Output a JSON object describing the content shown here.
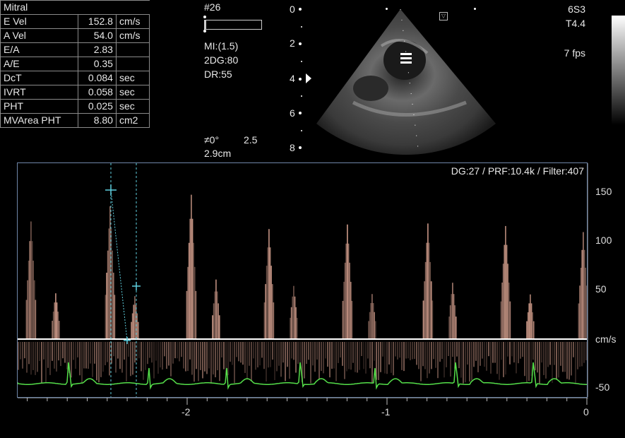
{
  "measurements": {
    "title": "Mitral",
    "rows": [
      {
        "label": "E Vel",
        "value": "152.8",
        "unit": "cm/s"
      },
      {
        "label": "A Vel",
        "value": "54.0",
        "unit": "cm/s"
      },
      {
        "label": "E/A",
        "value": "2.83",
        "unit": ""
      },
      {
        "label": "A/E",
        "value": "0.35",
        "unit": ""
      },
      {
        "label": "DcT",
        "value": "0.084",
        "unit": "sec"
      },
      {
        "label": "IVRT",
        "value": "0.058",
        "unit": "sec"
      },
      {
        "label": "PHT",
        "value": "0.025",
        "unit": "sec"
      },
      {
        "label": "MVArea PHT",
        "value": "8.80",
        "unit": "cm2"
      }
    ]
  },
  "scan_info": {
    "frame_number": "#26",
    "mi": "MI:(1.5)",
    "gain": "2DG:80",
    "dr": "DR:55",
    "angle": "≠0°",
    "angle_value": "2.5",
    "gate_depth": "2.9cm"
  },
  "probe": {
    "name": "6S3",
    "preset": "T4.4",
    "frame_rate": "7 fps"
  },
  "depth_scale": {
    "labels": [
      "0",
      "2",
      "4",
      "6",
      "8"
    ]
  },
  "doppler": {
    "header": "DG:27 /   PRF:10.4k / Filter:407",
    "velocity_labels": [
      "150",
      "100",
      "50",
      "cm/s",
      "-50"
    ],
    "time_labels": [
      "-2",
      "-1",
      "0"
    ]
  },
  "colors": {
    "spectrum": "#f0b4a0",
    "ecg": "#55e04a",
    "caliper": "#5fd0e0",
    "frame": "#6f86a8"
  }
}
